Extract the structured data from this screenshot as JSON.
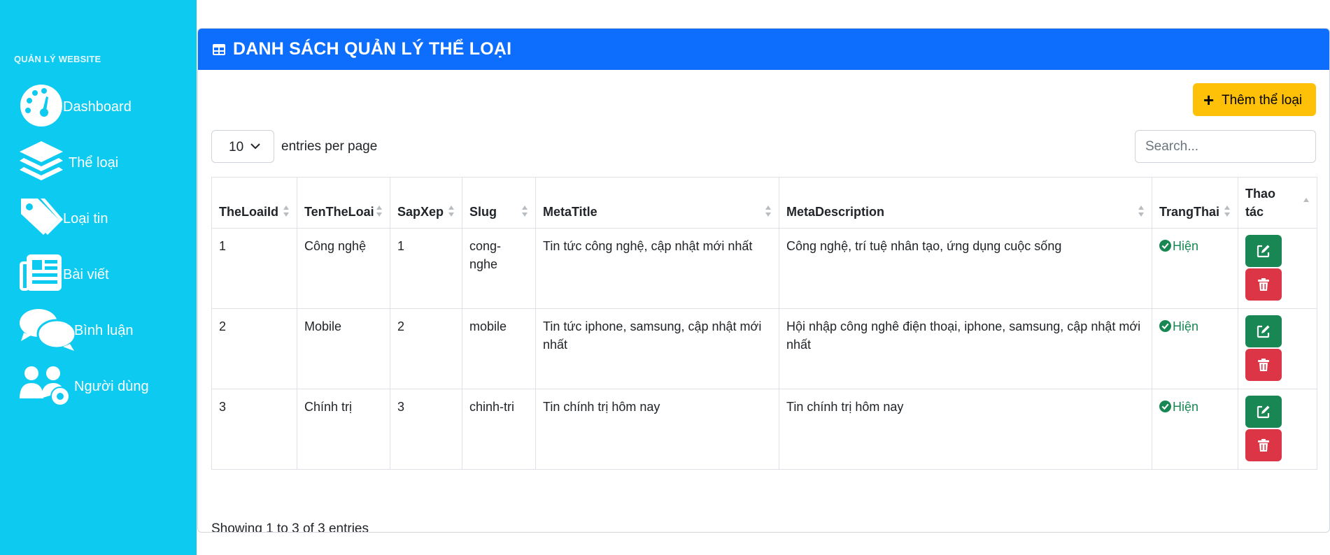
{
  "sidebar": {
    "heading": "QUẢN LÝ WEBSITE",
    "items": [
      {
        "label": "Dashboard",
        "icon": "gauge-icon"
      },
      {
        "label": "Thể loại",
        "icon": "layers-icon"
      },
      {
        "label": "Loại tin",
        "icon": "tags-icon"
      },
      {
        "label": "Bài viết",
        "icon": "newspaper-icon"
      },
      {
        "label": "Bình luận",
        "icon": "comments-icon"
      },
      {
        "label": "Người dùng",
        "icon": "users-gear-icon"
      }
    ]
  },
  "header": {
    "title": "DANH SÁCH QUẢN LÝ THỂ LOẠI",
    "icon": "table-icon"
  },
  "toolbar": {
    "add_label": "Thêm thể loại",
    "per_page_value": "10",
    "per_page_label": "entries per page",
    "search_placeholder": "Search..."
  },
  "table": {
    "columns": [
      "TheLoaiId",
      "TenTheLoai",
      "SapXep",
      "Slug",
      "MetaTitle",
      "MetaDescription",
      "TrangThai",
      "Thao tác"
    ],
    "rows": [
      {
        "id": "1",
        "name": "Công nghệ",
        "order": "1",
        "slug": "cong-nghe",
        "meta_title": "Tin tức công nghệ, cập nhật mới nhất",
        "meta_description": "Công nghệ, trí tuệ nhân tạo, ứng dụng cuộc sống",
        "status": "Hiện"
      },
      {
        "id": "2",
        "name": "Mobile",
        "order": "2",
        "slug": "mobile",
        "meta_title": "Tin tức iphone, samsung, cập nhật mới nhất",
        "meta_description": "Hội nhập công nghê điện thoại, iphone, samsung, cập nhật mới nhất",
        "status": "Hiện"
      },
      {
        "id": "3",
        "name": "Chính trị",
        "order": "3",
        "slug": "chinh-tri",
        "meta_title": "Tin chính trị hôm nay",
        "meta_description": "Tin chính trị hôm nay",
        "status": "Hiện"
      }
    ]
  },
  "footer": {
    "info": "Showing 1 to 3 of 3 entries"
  },
  "colors": {
    "sidebar": "#0dcaf0",
    "header": "#0d6efd",
    "add_button": "#ffc107",
    "edit_button": "#198754",
    "delete_button": "#dc3545",
    "status": "#198754"
  }
}
